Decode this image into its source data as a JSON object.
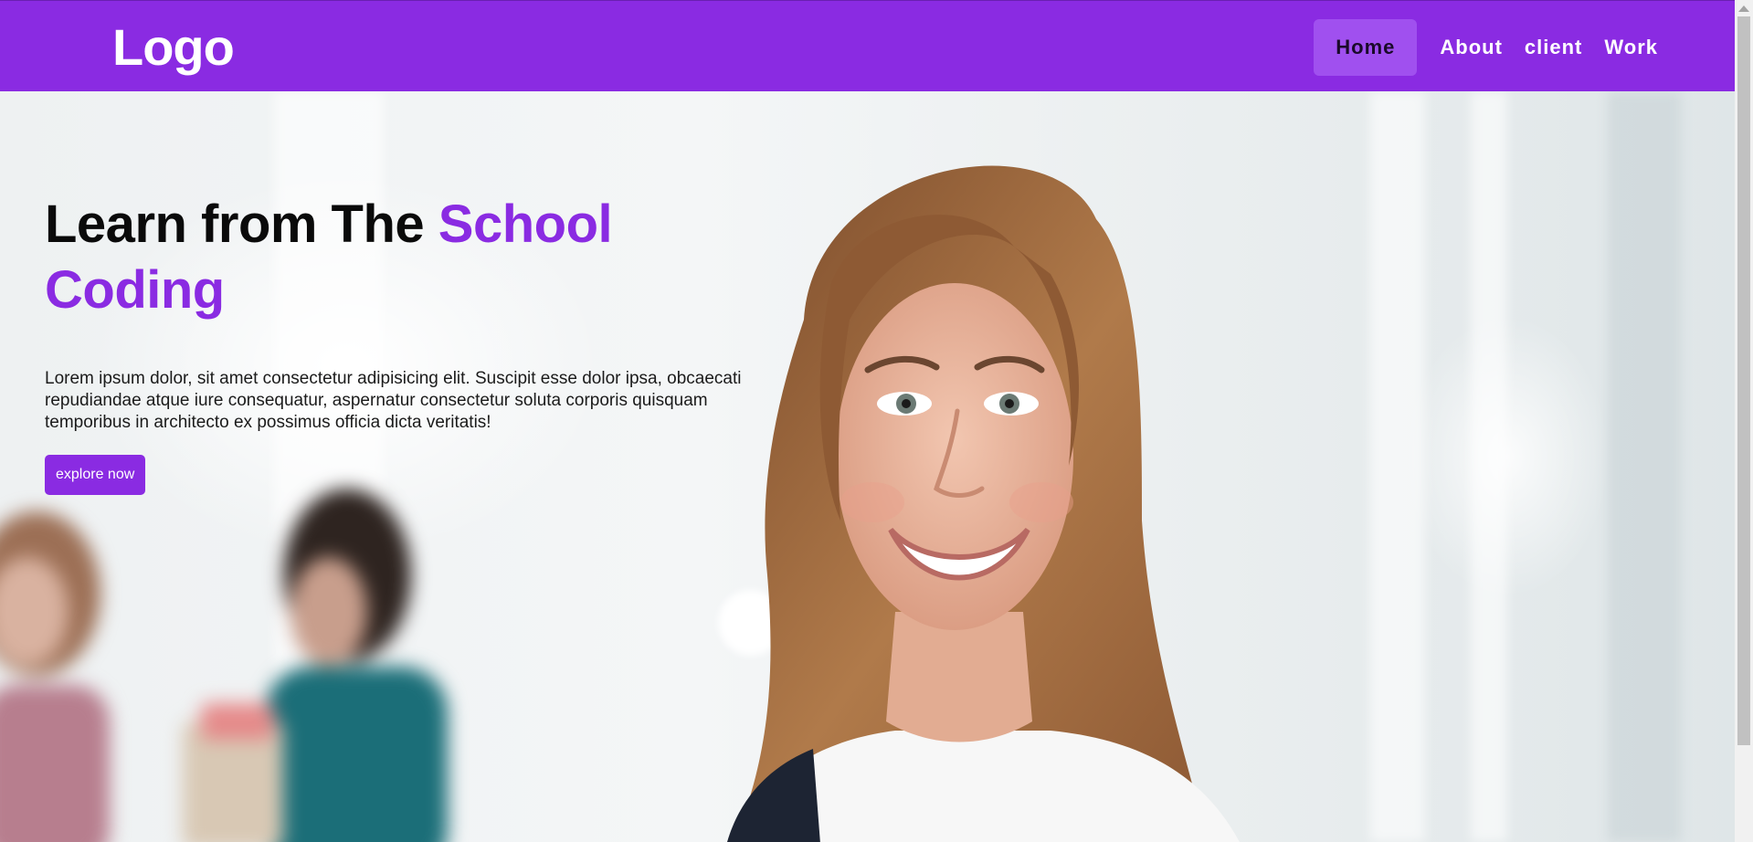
{
  "brand": {
    "logo_text": "Logo",
    "accent_color": "#8a2be2"
  },
  "nav": {
    "items": [
      {
        "label": "Home",
        "active": true
      },
      {
        "label": "About",
        "active": false
      },
      {
        "label": "client",
        "active": false
      },
      {
        "label": "Work",
        "active": false
      }
    ]
  },
  "hero": {
    "title_plain": "Learn from The",
    "title_accent": "School Coding",
    "body": "Lorem ipsum dolor, sit amet consectetur adipisicing elit. Suscipit esse dolor ipsa, obcaecati repudiandae atque iure consequatur, aspernatur consectetur soluta corporis quisquam temporibus in architecto ex possimus officia dicta veritatis!",
    "cta_label": "explore now"
  },
  "icons": {
    "scroll_up": "scroll-up-arrow-icon"
  }
}
